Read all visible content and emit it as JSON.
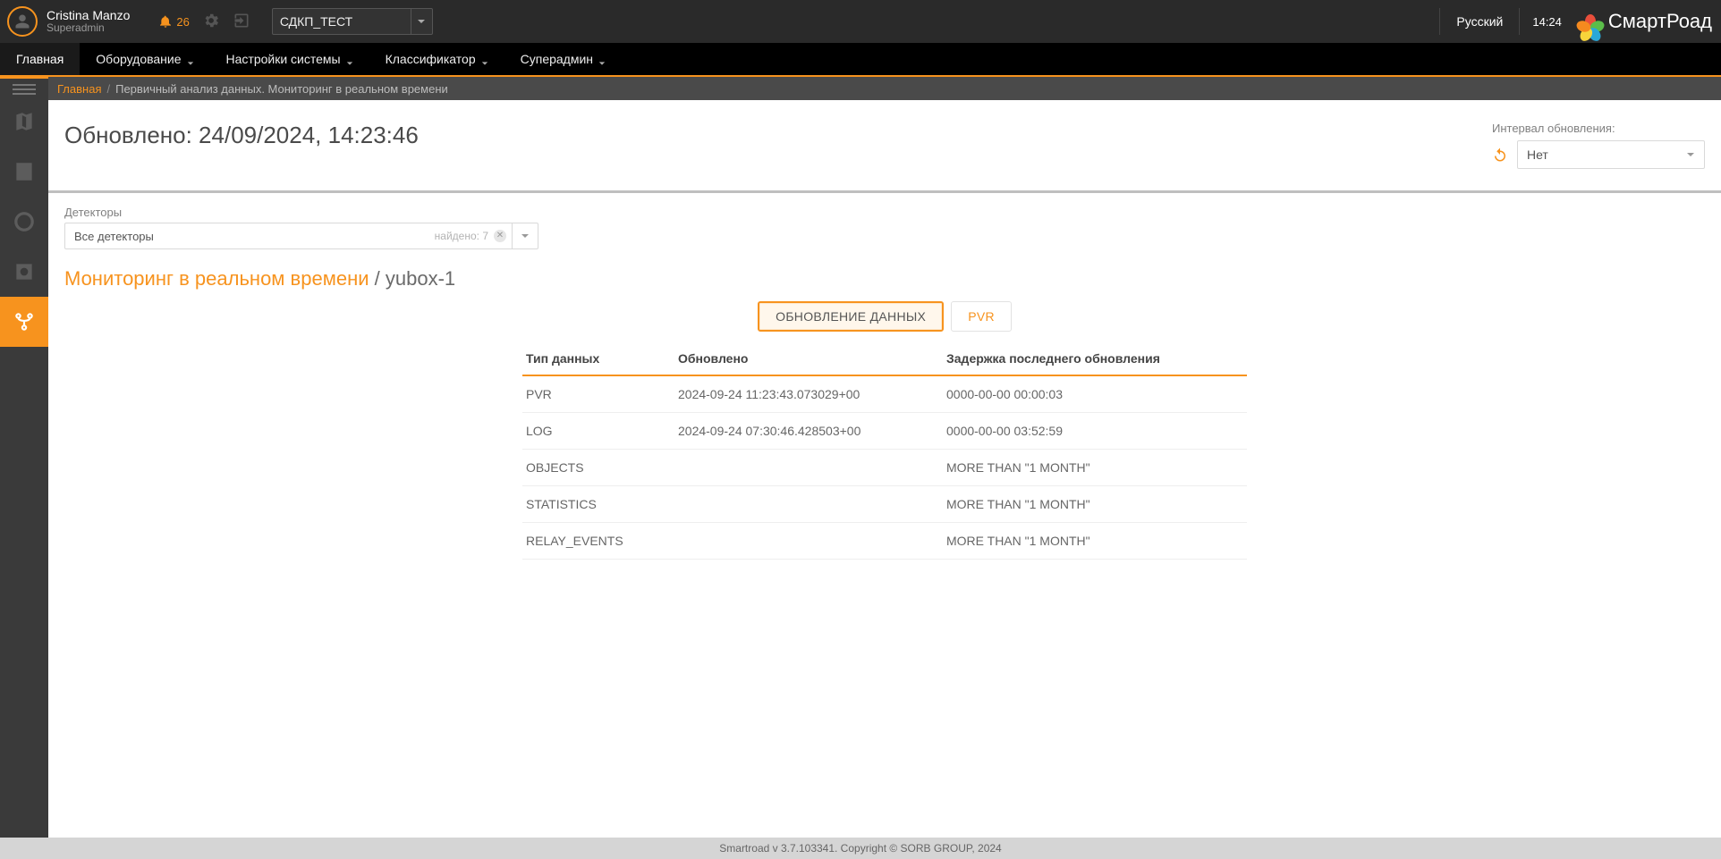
{
  "header": {
    "user_name": "Cristina Manzo",
    "user_role": "Superadmin",
    "notif_count": "26",
    "project_selected": "СДКП_ТЕСТ",
    "language": "Русский",
    "clock": "14:24",
    "brand": "СмартРоад"
  },
  "nav": {
    "items": [
      {
        "label": "Главная",
        "has_sub": false,
        "active": true
      },
      {
        "label": "Оборудование",
        "has_sub": true
      },
      {
        "label": "Настройки системы",
        "has_sub": true
      },
      {
        "label": "Классификатор",
        "has_sub": true
      },
      {
        "label": "Суперадмин",
        "has_sub": true
      }
    ]
  },
  "breadcrumb": {
    "home": "Главная",
    "current": "Первичный анализ данных. Мониторинг в реальном времени"
  },
  "page": {
    "updated_prefix": "Обновлено: ",
    "updated_value": "24/09/2024, 14:23:46",
    "interval_label": "Интервал обновления:",
    "interval_value": "Нет"
  },
  "filters": {
    "detectors_label": "Детекторы",
    "detectors_value": "Все детекторы",
    "detectors_found": "найдено: 7"
  },
  "section": {
    "monitoring": "Мониторинг в реальном времени",
    "sep": " / ",
    "device": "yubox-1"
  },
  "tabs": {
    "update": "ОБНОВЛЕНИЕ ДАННЫХ",
    "pvr": "PVR"
  },
  "table": {
    "headers": {
      "type": "Тип данных",
      "updated": "Обновлено",
      "delay": "Задержка последнего обновления"
    },
    "rows": [
      {
        "type": "PVR",
        "updated": "2024-09-24 11:23:43.073029+00",
        "delay": "0000-00-00 00:00:03"
      },
      {
        "type": "LOG",
        "updated": "2024-09-24 07:30:46.428503+00",
        "delay": "0000-00-00 03:52:59"
      },
      {
        "type": "OBJECTS",
        "updated": "",
        "delay": "MORE THAN \"1 MONTH\""
      },
      {
        "type": "STATISTICS",
        "updated": "",
        "delay": "MORE THAN \"1 MONTH\""
      },
      {
        "type": "RELAY_EVENTS",
        "updated": "",
        "delay": "MORE THAN \"1 MONTH\""
      }
    ]
  },
  "footer": {
    "text": "Smartroad v 3.7.103341. Copyright © SORB GROUP, 2024"
  }
}
